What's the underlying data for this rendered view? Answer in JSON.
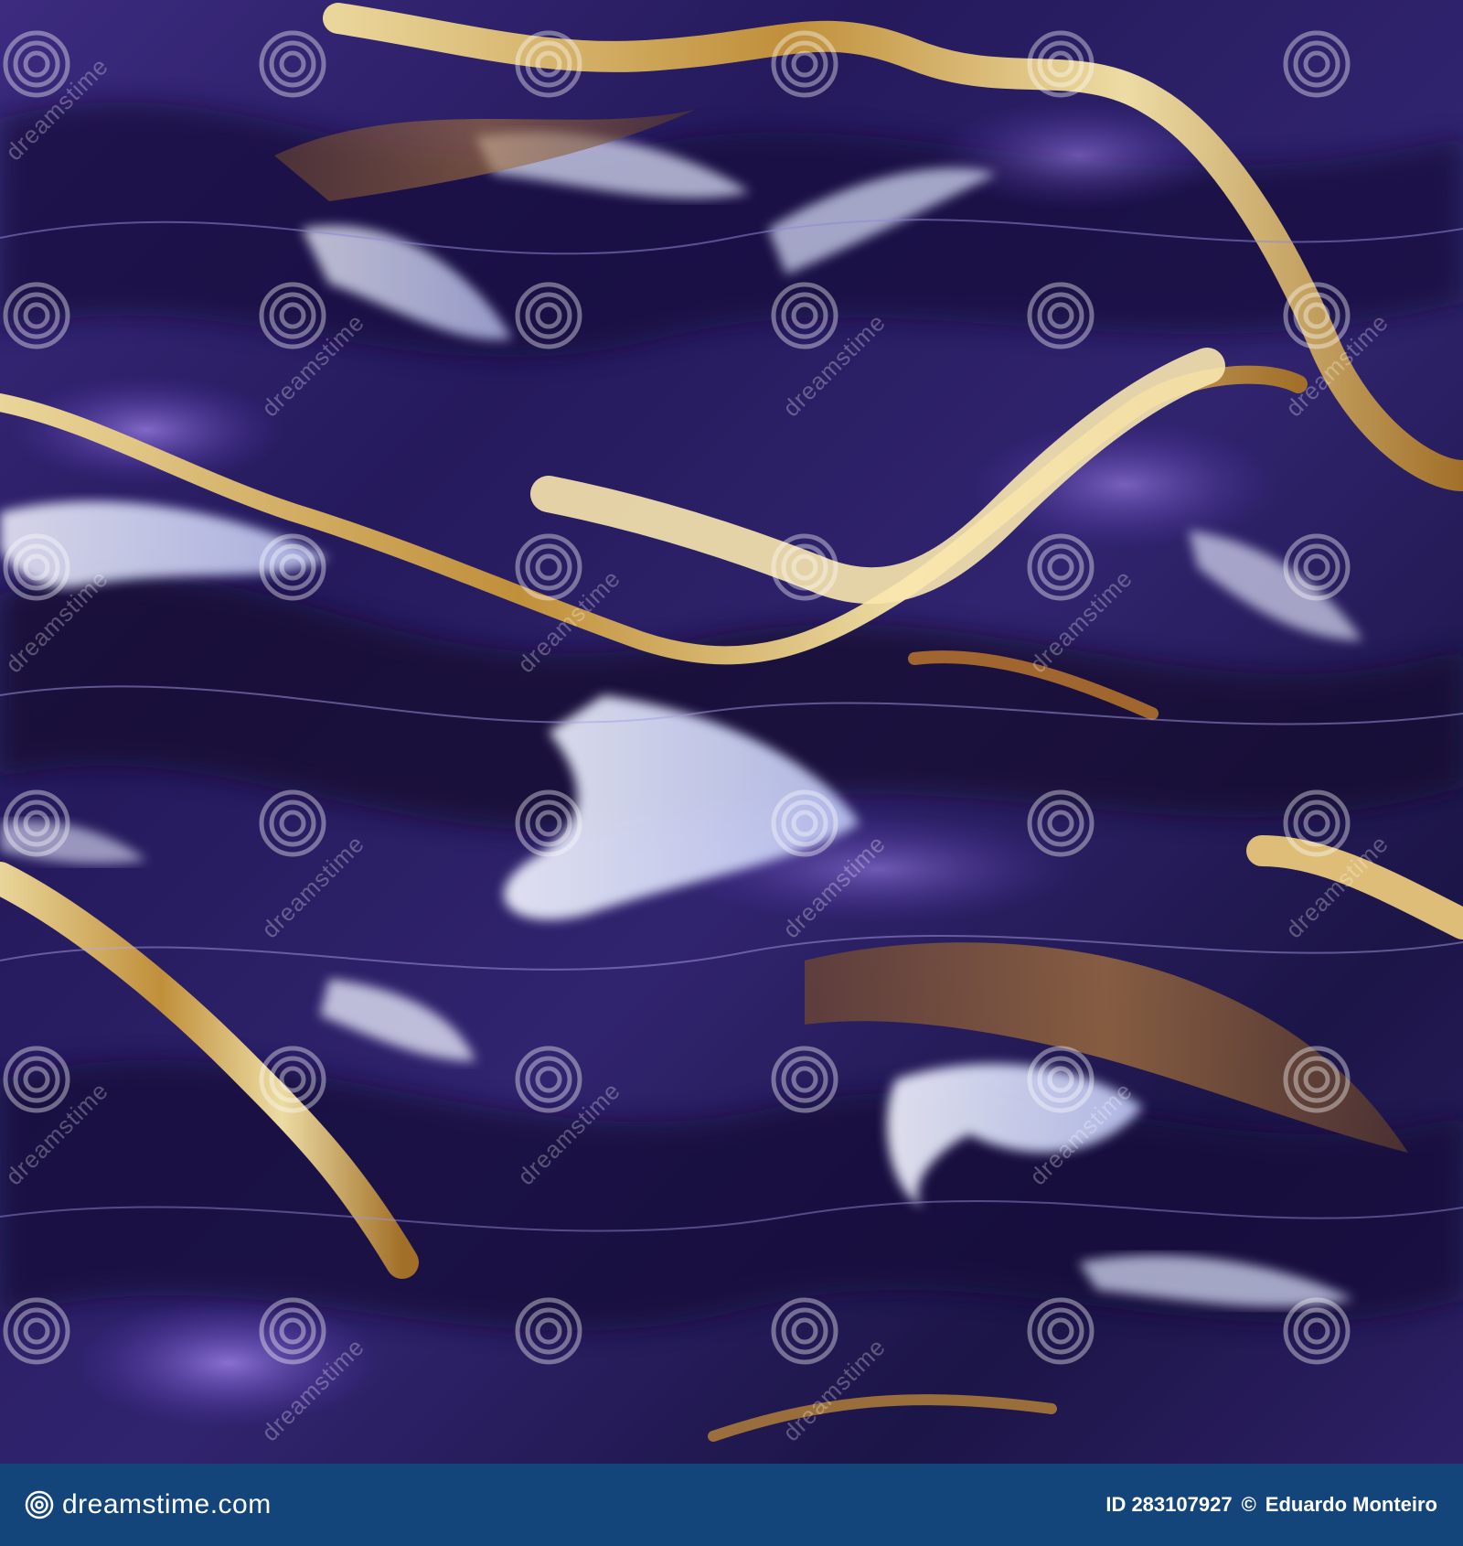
{
  "image": {
    "subject": "abstract-liquid-waves",
    "colors": {
      "deep_purple": "#2a1a63",
      "violet": "#5b36b7",
      "lavender_highlight": "#dfe6ff",
      "gold": "#d7aa4e",
      "bronze": "#8b5a2b"
    }
  },
  "watermark": {
    "logo_icon": "spiral-icon",
    "repeated_text": "dreamstime"
  },
  "footer": {
    "brand": "dreamstime.com",
    "id_label": "ID 283107927",
    "copyright_symbol": "©",
    "author": "Eduardo Monteiro",
    "background": "#14457a"
  }
}
